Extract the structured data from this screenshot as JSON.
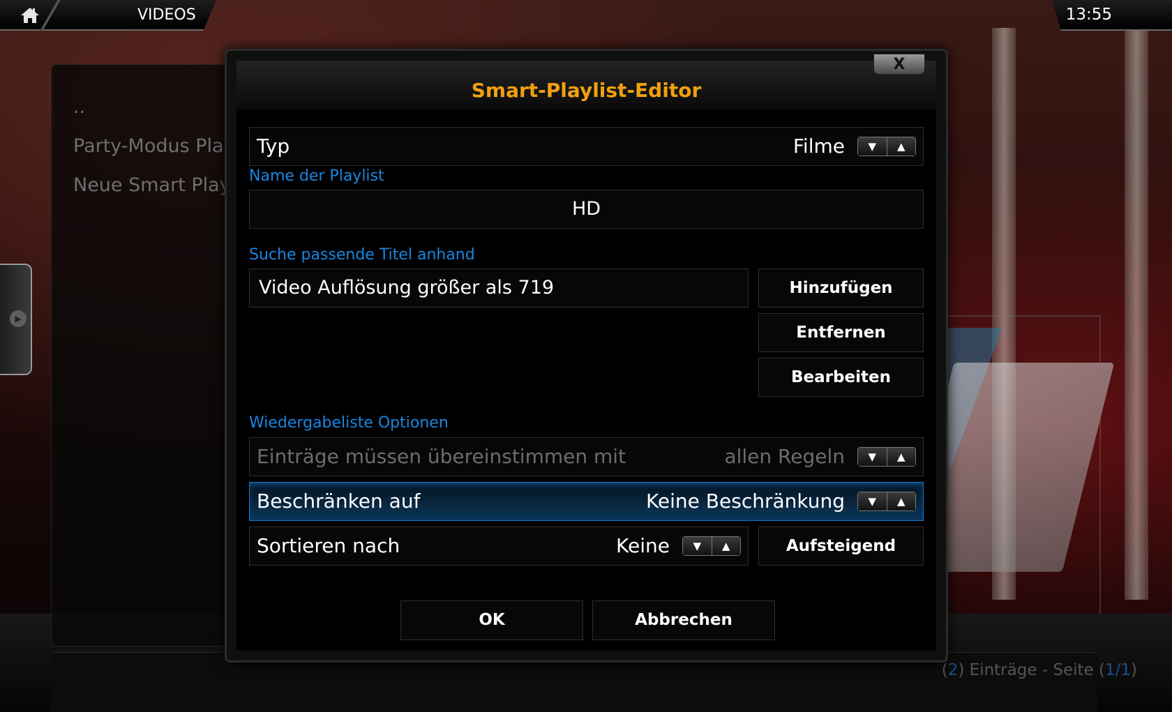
{
  "header": {
    "section_title": "VIDEOS",
    "clock": "13:55"
  },
  "sidebar": {
    "items": [
      {
        "label": ".."
      },
      {
        "label": "Party-Modus Play"
      },
      {
        "label": "Neue Smart Play"
      }
    ]
  },
  "footer": {
    "count_open": "(",
    "count": "2",
    "count_text": ") Einträge - Seite (",
    "page": "1/1",
    "page_close": ")"
  },
  "dialog": {
    "title": "Smart-Playlist-Editor",
    "close_label": "X",
    "type": {
      "label": "Typ",
      "value": "Filme"
    },
    "name_section_label": "Name der Playlist",
    "name_value": "HD",
    "rules_section_label": "Suche passende Titel anhand",
    "rules": [
      {
        "text": "Video Auflösung größer als 719"
      }
    ],
    "add_button": "Hinzufügen",
    "remove_button": "Entfernen",
    "edit_button": "Bearbeiten",
    "options_section_label": "Wiedergabeliste Optionen",
    "match": {
      "label": "Einträge müssen übereinstimmen mit",
      "value": "allen Regeln"
    },
    "limit": {
      "label": "Beschränken auf",
      "value": "Keine Beschränkung"
    },
    "sort": {
      "label": "Sortieren nach",
      "value": "Keine"
    },
    "order_button": "Aufsteigend",
    "ok_button": "OK",
    "cancel_button": "Abbrechen"
  },
  "icons": {
    "home": "home-icon",
    "spin_down": "▼",
    "spin_up": "▲",
    "side_arrow": "▶"
  },
  "colors": {
    "accent_blue": "#1b86e0",
    "title_orange": "#f0a010",
    "focus_blue": "#1a75c7"
  }
}
